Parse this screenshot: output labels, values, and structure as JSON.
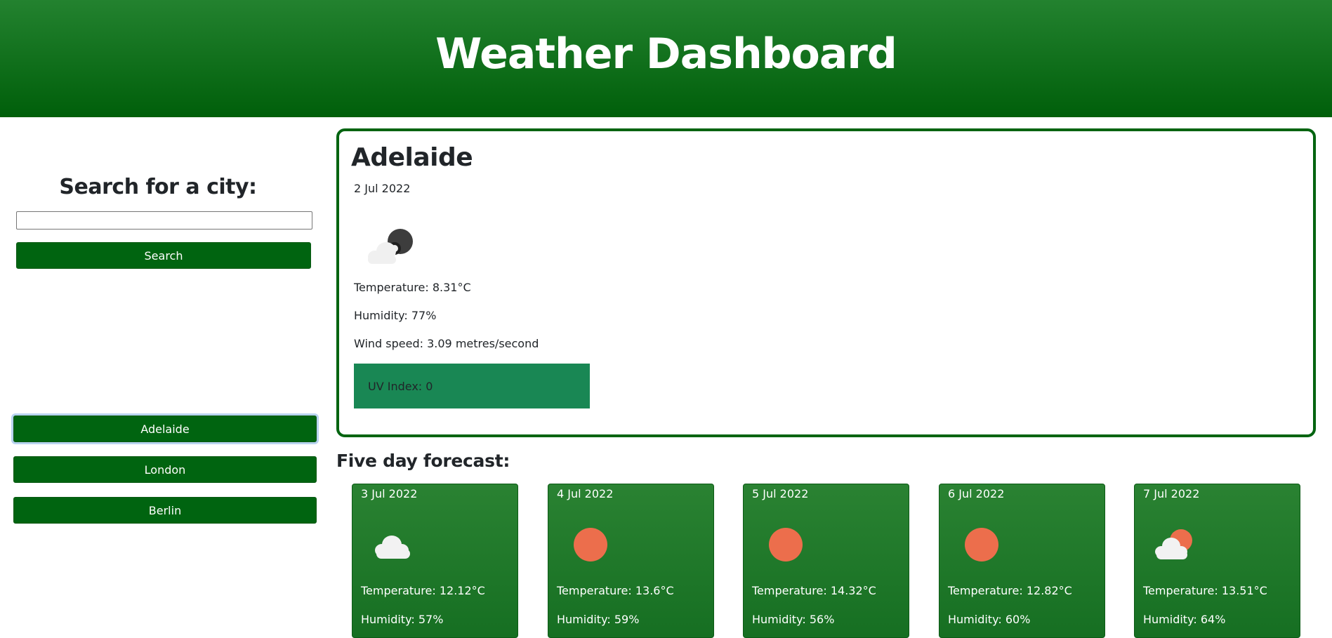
{
  "header": {
    "title": "Weather Dashboard"
  },
  "sidebar": {
    "search_title": "Search for a city:",
    "search_input": {
      "value": "",
      "placeholder": ""
    },
    "search_button": "Search",
    "history": [
      "Adelaide",
      "London",
      "Berlin"
    ]
  },
  "current": {
    "city": "Adelaide",
    "date": "2 Jul 2022",
    "icon": "partly-cloudy-night-icon",
    "temperature": "Temperature: 8.31°C",
    "humidity": "Humidity: 77%",
    "wind": "Wind speed: 3.09 metres/second",
    "uv": "UV Index: 0"
  },
  "forecast": {
    "title": "Five day forecast:",
    "days": [
      {
        "date": "3 Jul 2022",
        "icon": "cloud-icon",
        "temperature": "Temperature: 12.12°C",
        "humidity": "Humidity: 57%"
      },
      {
        "date": "4 Jul 2022",
        "icon": "sun-icon",
        "temperature": "Temperature: 13.6°C",
        "humidity": "Humidity: 59%"
      },
      {
        "date": "5 Jul 2022",
        "icon": "sun-icon",
        "temperature": "Temperature: 14.32°C",
        "humidity": "Humidity: 56%"
      },
      {
        "date": "6 Jul 2022",
        "icon": "sun-icon",
        "temperature": "Temperature: 12.82°C",
        "humidity": "Humidity: 60%"
      },
      {
        "date": "7 Jul 2022",
        "icon": "partly-cloudy-day-icon",
        "temperature": "Temperature: 13.51°C",
        "humidity": "Humidity: 64%"
      }
    ]
  },
  "colors": {
    "header_top": "#23822f",
    "header_bottom": "#005f0a",
    "button": "#006410",
    "uv_box": "#198754",
    "sun": "#ec6e4c"
  }
}
